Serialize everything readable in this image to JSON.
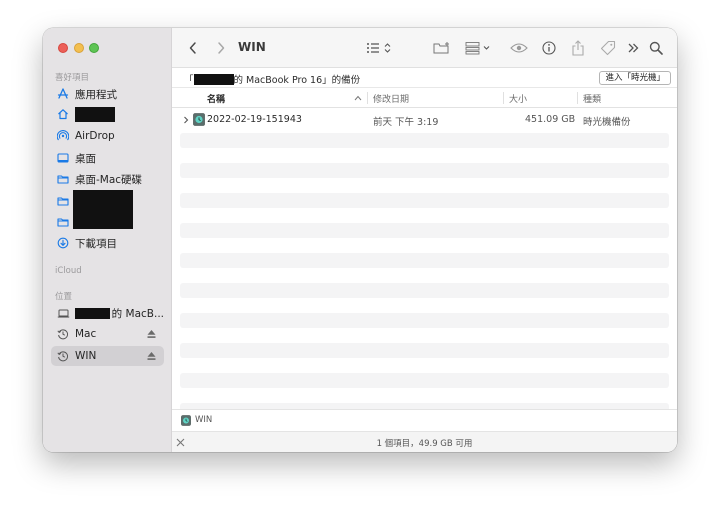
{
  "sidebar": {
    "favorites_header": "喜好項目",
    "items": [
      {
        "label": "應用程式",
        "icon": "apps-icon"
      },
      {
        "label": "",
        "icon": "home-icon"
      },
      {
        "label": "AirDrop",
        "icon": "airdrop-icon"
      },
      {
        "label": "桌面",
        "icon": "desktop-icon"
      },
      {
        "label": "桌面-Mac硬碟",
        "icon": "folder-icon"
      },
      {
        "label": "",
        "icon": "folder-icon"
      },
      {
        "label": "",
        "icon": "folder-icon"
      },
      {
        "label": "下載項目",
        "icon": "download-icon"
      }
    ],
    "icloud_header": "iCloud",
    "locations_header": "位置",
    "locations": [
      {
        "label": "的 MacB...",
        "icon": "laptop-icon"
      },
      {
        "label": "Mac",
        "icon": "timemachine-icon"
      },
      {
        "label": "WIN",
        "icon": "timemachine-icon",
        "selected": true
      }
    ]
  },
  "toolbar": {
    "title": "WIN"
  },
  "pathbar": {
    "prefix": "「",
    "suffix": "的 MacBook Pro 16」的備份",
    "enter_button": "進入「時光機」"
  },
  "columns": {
    "name": "名稱",
    "modified": "修改日期",
    "size": "大小",
    "kind": "種類"
  },
  "files": [
    {
      "name": "2022-02-19-151943",
      "modified": "前天 下午 3:19",
      "size": "451.09 GB",
      "kind": "時光機備份"
    }
  ],
  "location_bar": {
    "label": "WIN"
  },
  "status": {
    "text": "1 個項目，49.9 GB 可用"
  },
  "colors": {
    "accent": "#1a7ae6",
    "sidebar_bg": "#e5e3e5",
    "row_alt": "#f4f4f5"
  }
}
